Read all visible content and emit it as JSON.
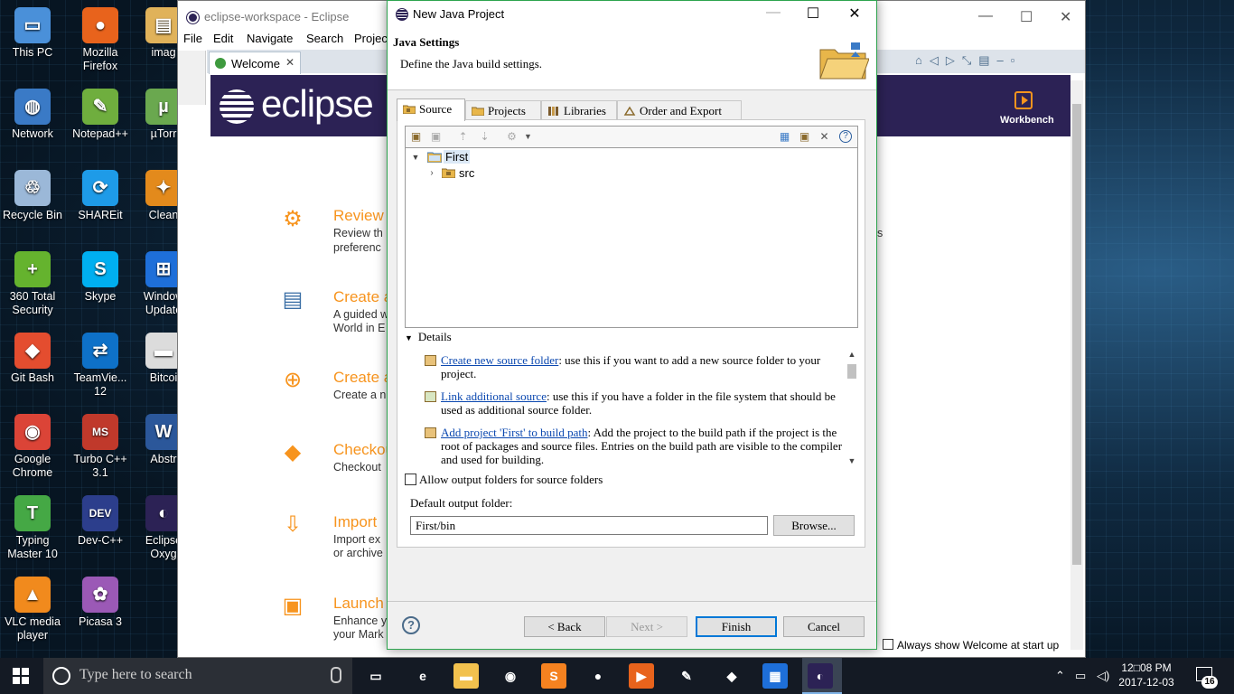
{
  "desktop": {
    "icons": [
      {
        "label": "This PC",
        "color": "#4a90d9",
        "glyph": "▭"
      },
      {
        "label": "Mozilla Firefox",
        "color": "#e8631c",
        "glyph": "●"
      },
      {
        "label": "imag",
        "color": "#e0b25a",
        "glyph": "▤"
      },
      {
        "label": "Network",
        "color": "#3a7ac6",
        "glyph": "◍"
      },
      {
        "label": "Notepad++",
        "color": "#6fae3e",
        "glyph": "✎"
      },
      {
        "label": "µTorr",
        "color": "#6aa84f",
        "glyph": "µ"
      },
      {
        "label": "Recycle Bin",
        "color": "#9bb8d8",
        "glyph": "♲"
      },
      {
        "label": "SHAREit",
        "color": "#1e9be8",
        "glyph": "⟳"
      },
      {
        "label": "Clean",
        "color": "#e38a1c",
        "glyph": "✦"
      },
      {
        "label": "360 Total Security",
        "color": "#65b32e",
        "glyph": "+"
      },
      {
        "label": "Skype",
        "color": "#00aff0",
        "glyph": "S"
      },
      {
        "label": "Window Update",
        "color": "#1e6fd9",
        "glyph": "⊞"
      },
      {
        "label": "Git Bash",
        "color": "#e44d2f",
        "glyph": "◆"
      },
      {
        "label": "TeamVie... 12",
        "color": "#0e71c8",
        "glyph": "⇄"
      },
      {
        "label": "Bitcoi",
        "color": "#dcdcdc",
        "glyph": "▬"
      },
      {
        "label": "Google Chrome",
        "color": "#db4437",
        "glyph": "◉"
      },
      {
        "label": "Turbo C++ 3.1",
        "color": "#c0392b",
        "glyph": "MS"
      },
      {
        "label": "Abstr",
        "color": "#2b579a",
        "glyph": "W"
      },
      {
        "label": "Typing Master 10",
        "color": "#45a845",
        "glyph": "T"
      },
      {
        "label": "Dev-C++",
        "color": "#2c3e8c",
        "glyph": "DEV"
      },
      {
        "label": "Eclipse Oxyg",
        "color": "#2c2255",
        "glyph": "◐"
      },
      {
        "label": "VLC media player",
        "color": "#f18a1d",
        "glyph": "▲"
      },
      {
        "label": "Picasa 3",
        "color": "#9b59b6",
        "glyph": "✿"
      }
    ]
  },
  "eclipse": {
    "window_title": "eclipse-workspace - Eclipse",
    "menu": [
      "File",
      "Edit",
      "Navigate",
      "Search",
      "Projec"
    ],
    "welcome_tab": "Welcome",
    "logo_text": "eclipse",
    "workbench_label": "Workbench",
    "items": [
      {
        "title": "Review",
        "desc1": "Review th",
        "desc2": "preferenc",
        "icon": "gear-icon"
      },
      {
        "title": "Create a",
        "desc1": "A guided w",
        "desc2": "World in E",
        "icon": "document-icon"
      },
      {
        "title": "Create a",
        "desc1": "Create a n",
        "desc2": "",
        "icon": "add-icon"
      },
      {
        "title": "Checkou",
        "desc1": "Checkout",
        "desc2": "",
        "icon": "git-icon"
      },
      {
        "title": "Import",
        "desc1": "Import ex",
        "desc2": "or archive",
        "icon": "download-icon"
      },
      {
        "title": "Launch",
        "desc1": "Enhance y",
        "desc2": "your Mark",
        "icon": "package-icon"
      }
    ],
    "side_text": "s",
    "footer_label": "Always show Welcome at start up"
  },
  "dialog": {
    "title": "New Java Project",
    "header_title": "Java Settings",
    "header_subtitle": "Define the Java build settings.",
    "tabs": [
      "Source",
      "Projects",
      "Libraries",
      "Order and Export"
    ],
    "tree": {
      "project": "First",
      "folder": "src"
    },
    "details_label": "Details",
    "details": [
      {
        "link": "Create new source folder",
        "text": ": use this if you want to add a new source folder to your project."
      },
      {
        "link": "Link additional source",
        "text": ": use this if you have a folder in the file system that should be used as additional source folder."
      },
      {
        "link": "Add project 'First' to build path",
        "text": ": Add the project to the build path if the project is the root of packages and source files. Entries on the build path are visible to the compiler and used for building."
      }
    ],
    "allow_output_label": "Allow output folders for source folders",
    "default_output_label": "Default output folder:",
    "default_output_value": "First/bin",
    "browse_label": "Browse...",
    "back_label": "< Back",
    "next_label": "Next >",
    "finish_label": "Finish",
    "cancel_label": "Cancel",
    "help_symbol": "?"
  },
  "taskbar": {
    "search_placeholder": "Type here to search",
    "clock_time": "12□08 PM",
    "clock_date": "2017-12-03",
    "notification_count": "16",
    "apps": [
      {
        "name": "task-view",
        "color": "#141a24",
        "glyph": "▭"
      },
      {
        "name": "edge",
        "color": "#141a24",
        "glyph": "e"
      },
      {
        "name": "file-explorer",
        "color": "#f2c14e",
        "glyph": "▬"
      },
      {
        "name": "chrome",
        "color": "#141a24",
        "glyph": "◉"
      },
      {
        "name": "sublime",
        "color": "#f58220",
        "glyph": "S"
      },
      {
        "name": "firefox",
        "color": "#141a24",
        "glyph": "●"
      },
      {
        "name": "media-player",
        "color": "#e8631c",
        "glyph": "▶"
      },
      {
        "name": "notepad",
        "color": "#141a24",
        "glyph": "✎"
      },
      {
        "name": "git",
        "color": "#141a24",
        "glyph": "◆"
      },
      {
        "name": "control-panel",
        "color": "#1e6fd9",
        "glyph": "▦"
      },
      {
        "name": "eclipse",
        "color": "#2c2255",
        "glyph": "◐"
      }
    ]
  }
}
